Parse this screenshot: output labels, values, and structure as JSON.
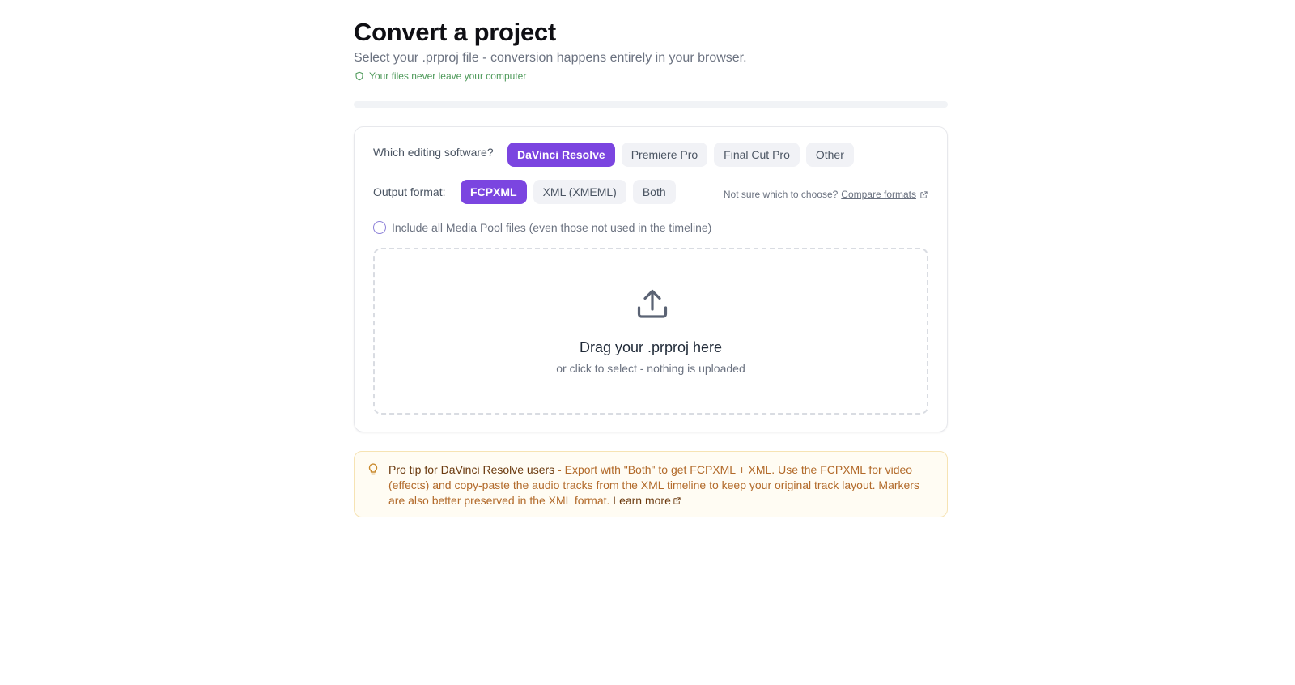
{
  "header": {
    "title": "Convert a project",
    "subtitle": "Select your .prproj file - conversion happens entirely in your browser.",
    "privacy_note": "Your files never leave your computer",
    "progress": 0
  },
  "software": {
    "label": "Which editing software?",
    "options": [
      "DaVinci Resolve",
      "Premiere Pro",
      "Final Cut Pro",
      "Other"
    ],
    "selected": "DaVinci Resolve"
  },
  "output": {
    "label": "Output format:",
    "options": [
      "FCPXML",
      "XML (XMEML)",
      "Both"
    ],
    "selected": "FCPXML",
    "help_text": "Not sure which to choose?",
    "compare_link": "Compare formats"
  },
  "media_pool": {
    "label": "Include all Media Pool files (even those not used in the timeline)",
    "checked": false
  },
  "dropzone": {
    "title": "Drag your .prproj here",
    "subtitle": "or click to select - nothing is uploaded",
    "icon": "upload-icon"
  },
  "tip": {
    "heading": "Pro tip for DaVinci Resolve users",
    "body": " - Export with \"Both\" to get FCPXML + XML. Use the FCPXML for video (effects) and copy-paste the audio tracks from the XML timeline to keep your original track layout. Markers are also better preserved in the XML format. ",
    "link": "Learn more",
    "icon": "lightbulb-icon"
  },
  "colors": {
    "accent": "#7b45e0",
    "tip_background": "#fffcf3",
    "tip_text": "#b26a2a",
    "privacy_green": "#4f9a5b"
  }
}
